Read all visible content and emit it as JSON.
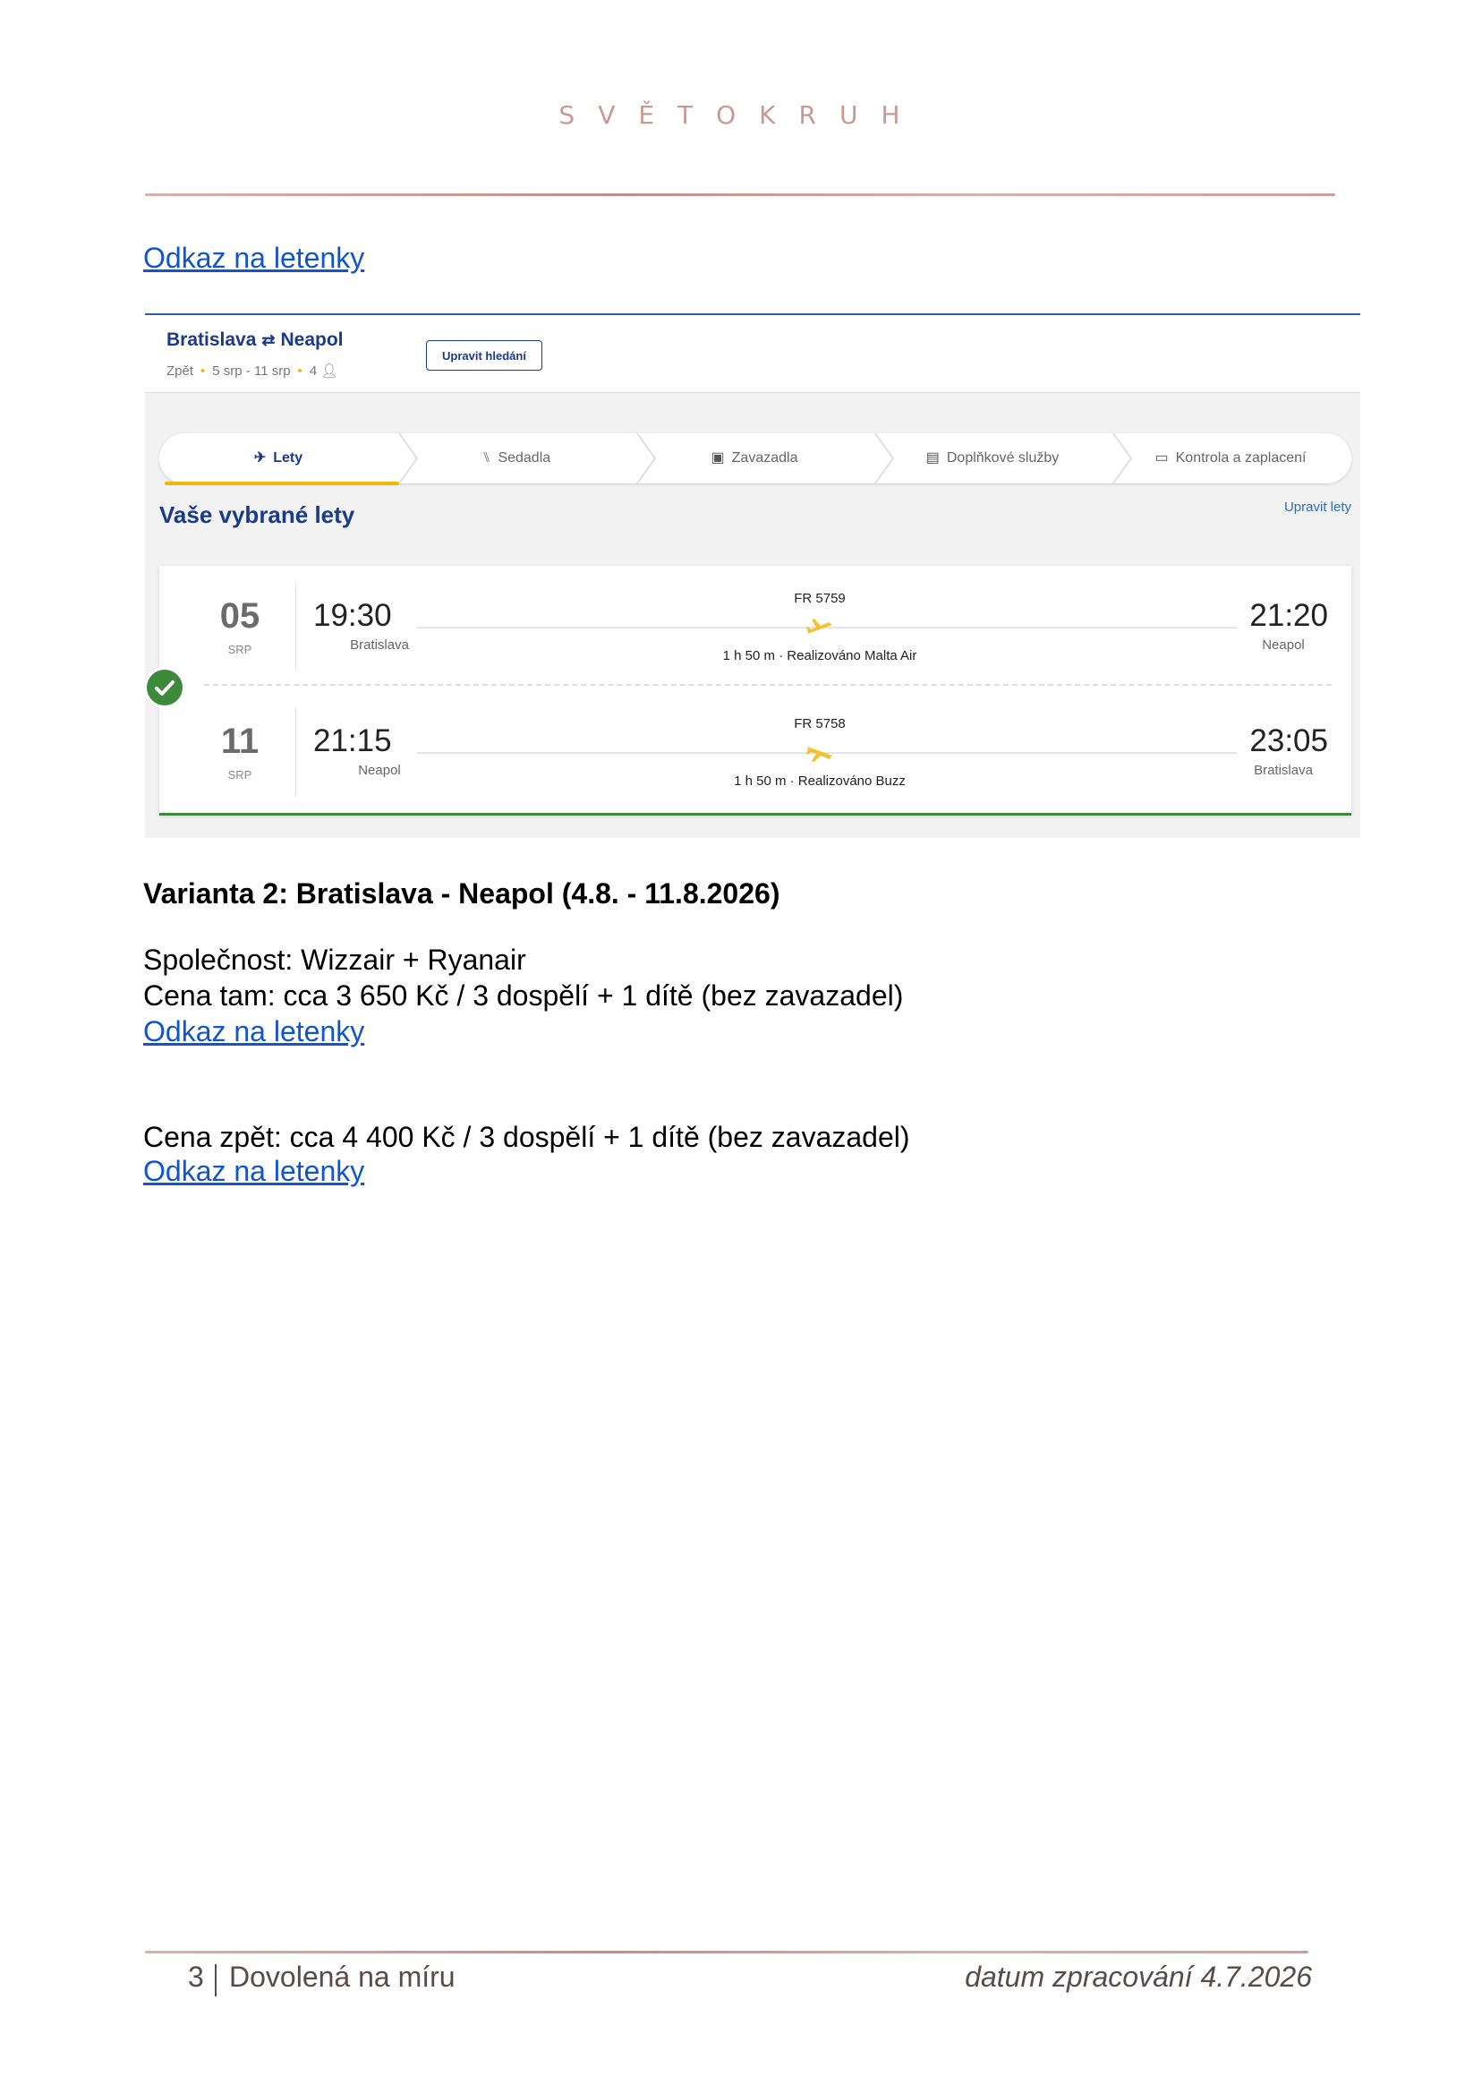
{
  "brand": "SVĚTOKRUH",
  "links": {
    "top": "Odkaz na letenky",
    "there": "Odkaz na letenky",
    "back": "Odkaz na letenky"
  },
  "booking": {
    "from": "Bratislava",
    "to": "Neapol",
    "trip_type": "Zpět",
    "dates": "5 srp - 11 srp",
    "passengers": "4",
    "edit_search": "Upravit hledání",
    "steps": [
      "Lety",
      "Sedadla",
      "Zavazadla",
      "Doplňkové služby",
      "Kontrola a zaplacení"
    ],
    "selected_title": "Vaše vybrané lety",
    "edit_flights": "Upravit lety",
    "accent_color": "#f2b705",
    "brand_color": "#1a3a8c",
    "flights": [
      {
        "day": "05",
        "month": "SRP",
        "dep_time": "19:30",
        "dep_city": "Bratislava",
        "flight_no": "FR 5759",
        "duration": "1 h 50 m · Realizováno Malta Air",
        "arr_time": "21:20",
        "arr_city": "Neapol"
      },
      {
        "day": "11",
        "month": "SRP",
        "dep_time": "21:15",
        "dep_city": "Neapol",
        "flight_no": "FR 5758",
        "duration": "1 h 50 m · Realizováno Buzz",
        "arr_time": "23:05",
        "arr_city": "Bratislava"
      }
    ]
  },
  "variant2": {
    "heading": "Varianta 2: Bratislava - Neapol (4.8. - 11.8.2026)",
    "company": "Společnost: Wizzair + Ryanair",
    "price_there": "Cena tam: cca 3 650 Kč / 3 dospělí + 1 dítě (bez zavazadel)",
    "price_back": "Cena zpět: cca 4 400 Kč / 3 dospělí + 1 dítě (bez zavazadel)"
  },
  "footer": {
    "page": "3",
    "title": "Dovolená na míru",
    "date": "datum zpracování 4.7.2026"
  }
}
